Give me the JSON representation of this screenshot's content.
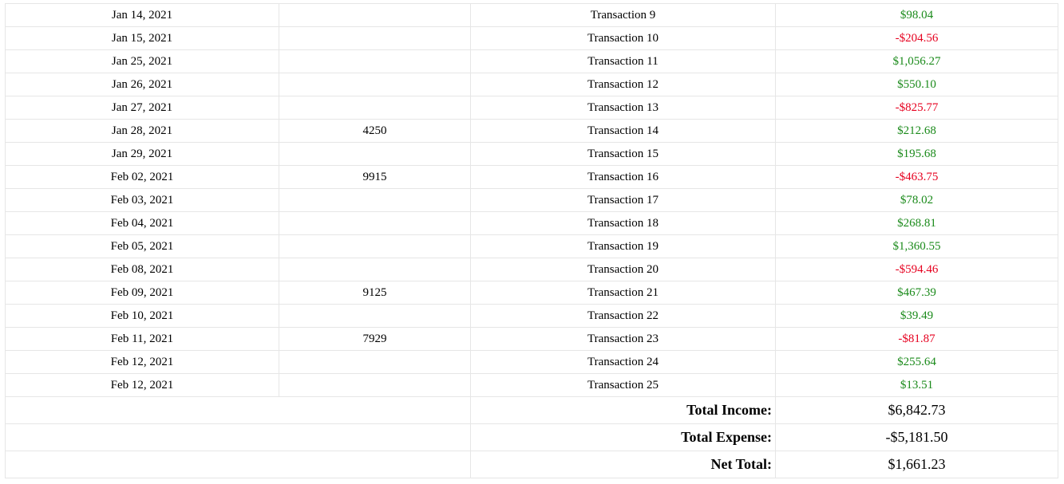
{
  "rows": [
    {
      "date": "Jan 14, 2021",
      "check": "",
      "description": "Transaction 9",
      "amount": "$98.04",
      "type": "pos"
    },
    {
      "date": "Jan 15, 2021",
      "check": "",
      "description": "Transaction 10",
      "amount": "-$204.56",
      "type": "neg"
    },
    {
      "date": "Jan 25, 2021",
      "check": "",
      "description": "Transaction 11",
      "amount": "$1,056.27",
      "type": "pos"
    },
    {
      "date": "Jan 26, 2021",
      "check": "",
      "description": "Transaction 12",
      "amount": "$550.10",
      "type": "pos"
    },
    {
      "date": "Jan 27, 2021",
      "check": "",
      "description": "Transaction 13",
      "amount": "-$825.77",
      "type": "neg"
    },
    {
      "date": "Jan 28, 2021",
      "check": "4250",
      "description": "Transaction 14",
      "amount": "$212.68",
      "type": "pos"
    },
    {
      "date": "Jan 29, 2021",
      "check": "",
      "description": "Transaction 15",
      "amount": "$195.68",
      "type": "pos"
    },
    {
      "date": "Feb 02, 2021",
      "check": "9915",
      "description": "Transaction 16",
      "amount": "-$463.75",
      "type": "neg"
    },
    {
      "date": "Feb 03, 2021",
      "check": "",
      "description": "Transaction 17",
      "amount": "$78.02",
      "type": "pos"
    },
    {
      "date": "Feb 04, 2021",
      "check": "",
      "description": "Transaction 18",
      "amount": "$268.81",
      "type": "pos"
    },
    {
      "date": "Feb 05, 2021",
      "check": "",
      "description": "Transaction 19",
      "amount": "$1,360.55",
      "type": "pos"
    },
    {
      "date": "Feb 08, 2021",
      "check": "",
      "description": "Transaction 20",
      "amount": "-$594.46",
      "type": "neg"
    },
    {
      "date": "Feb 09, 2021",
      "check": "9125",
      "description": "Transaction 21",
      "amount": "$467.39",
      "type": "pos"
    },
    {
      "date": "Feb 10, 2021",
      "check": "",
      "description": "Transaction 22",
      "amount": "$39.49",
      "type": "pos"
    },
    {
      "date": "Feb 11, 2021",
      "check": "7929",
      "description": "Transaction 23",
      "amount": "-$81.87",
      "type": "neg"
    },
    {
      "date": "Feb 12, 2021",
      "check": "",
      "description": "Transaction 24",
      "amount": "$255.64",
      "type": "pos"
    },
    {
      "date": "Feb 12, 2021",
      "check": "",
      "description": "Transaction 25",
      "amount": "$13.51",
      "type": "pos"
    }
  ],
  "totals": {
    "income_label": "Total Income:",
    "income_value": "$6,842.73",
    "expense_label": "Total Expense:",
    "expense_value": "-$5,181.50",
    "net_label": "Net Total:",
    "net_value": "$1,661.23"
  },
  "colors": {
    "income": "#1a8a1a",
    "expense": "#e6001f",
    "grid": "#e6e6e6"
  }
}
